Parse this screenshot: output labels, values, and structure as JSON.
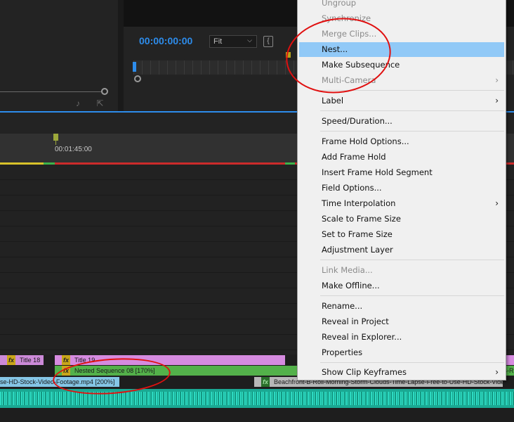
{
  "program_monitor": {
    "timecode": "00:00:00:00",
    "zoom": "Fit",
    "zoom_chevron": "⌵",
    "bracket_glyph": "{"
  },
  "source_monitor": {
    "icons": [
      "audio-only-icon",
      "export-frame-icon"
    ],
    "icon_glyphs": "♪ ⇱"
  },
  "timeline": {
    "ruler_time": "00:01:45:00",
    "clips": {
      "title18": "Title 18",
      "title19": "Title 19",
      "nested": "Nested Sequence 08 [170%]",
      "footage1": "se-HD-Stock-Video-Footage.mp4 [200%]",
      "footage2": "Beachfront-B-Roll-Morning-Storm-Clouds-Time-Lapse-Free-to-Use-HD-Stock-Video",
      "right_stub": "B-R"
    },
    "fx_label": "fx"
  },
  "context_menu": {
    "items": [
      {
        "label": "Ungroup",
        "enabled": false
      },
      {
        "label": "Synchronize",
        "enabled": false
      },
      {
        "label": "Merge Clips...",
        "enabled": false
      },
      {
        "label": "Nest...",
        "enabled": true,
        "highlighted": true
      },
      {
        "label": "Make Subsequence",
        "enabled": true
      },
      {
        "label": "Multi-Camera",
        "enabled": false,
        "submenu": true
      },
      {
        "label": "Label",
        "enabled": true,
        "submenu": true
      },
      {
        "label": "Speed/Duration...",
        "enabled": true
      },
      {
        "label": "Frame Hold Options...",
        "enabled": true
      },
      {
        "label": "Add Frame Hold",
        "enabled": true
      },
      {
        "label": "Insert Frame Hold Segment",
        "enabled": true
      },
      {
        "label": "Field Options...",
        "enabled": true
      },
      {
        "label": "Time Interpolation",
        "enabled": true,
        "submenu": true
      },
      {
        "label": "Scale to Frame Size",
        "enabled": true
      },
      {
        "label": "Set to Frame Size",
        "enabled": true
      },
      {
        "label": "Adjustment Layer",
        "enabled": true
      },
      {
        "label": "Link Media...",
        "enabled": false
      },
      {
        "label": "Make Offline...",
        "enabled": true
      },
      {
        "label": "Rename...",
        "enabled": true
      },
      {
        "label": "Reveal in Project",
        "enabled": true
      },
      {
        "label": "Reveal in Explorer...",
        "enabled": true
      },
      {
        "label": "Properties",
        "enabled": true
      },
      {
        "label": "Show Clip Keyframes",
        "enabled": true,
        "submenu": true
      }
    ],
    "submenu_arrow": "›"
  },
  "colors": {
    "accent_blue": "#2d8ceb",
    "menu_highlight": "#91c9f7",
    "annotation_red": "#e01010",
    "title_clip": "#d68be0",
    "nested_clip": "#53b14a",
    "audio_clip": "#1aa993"
  }
}
